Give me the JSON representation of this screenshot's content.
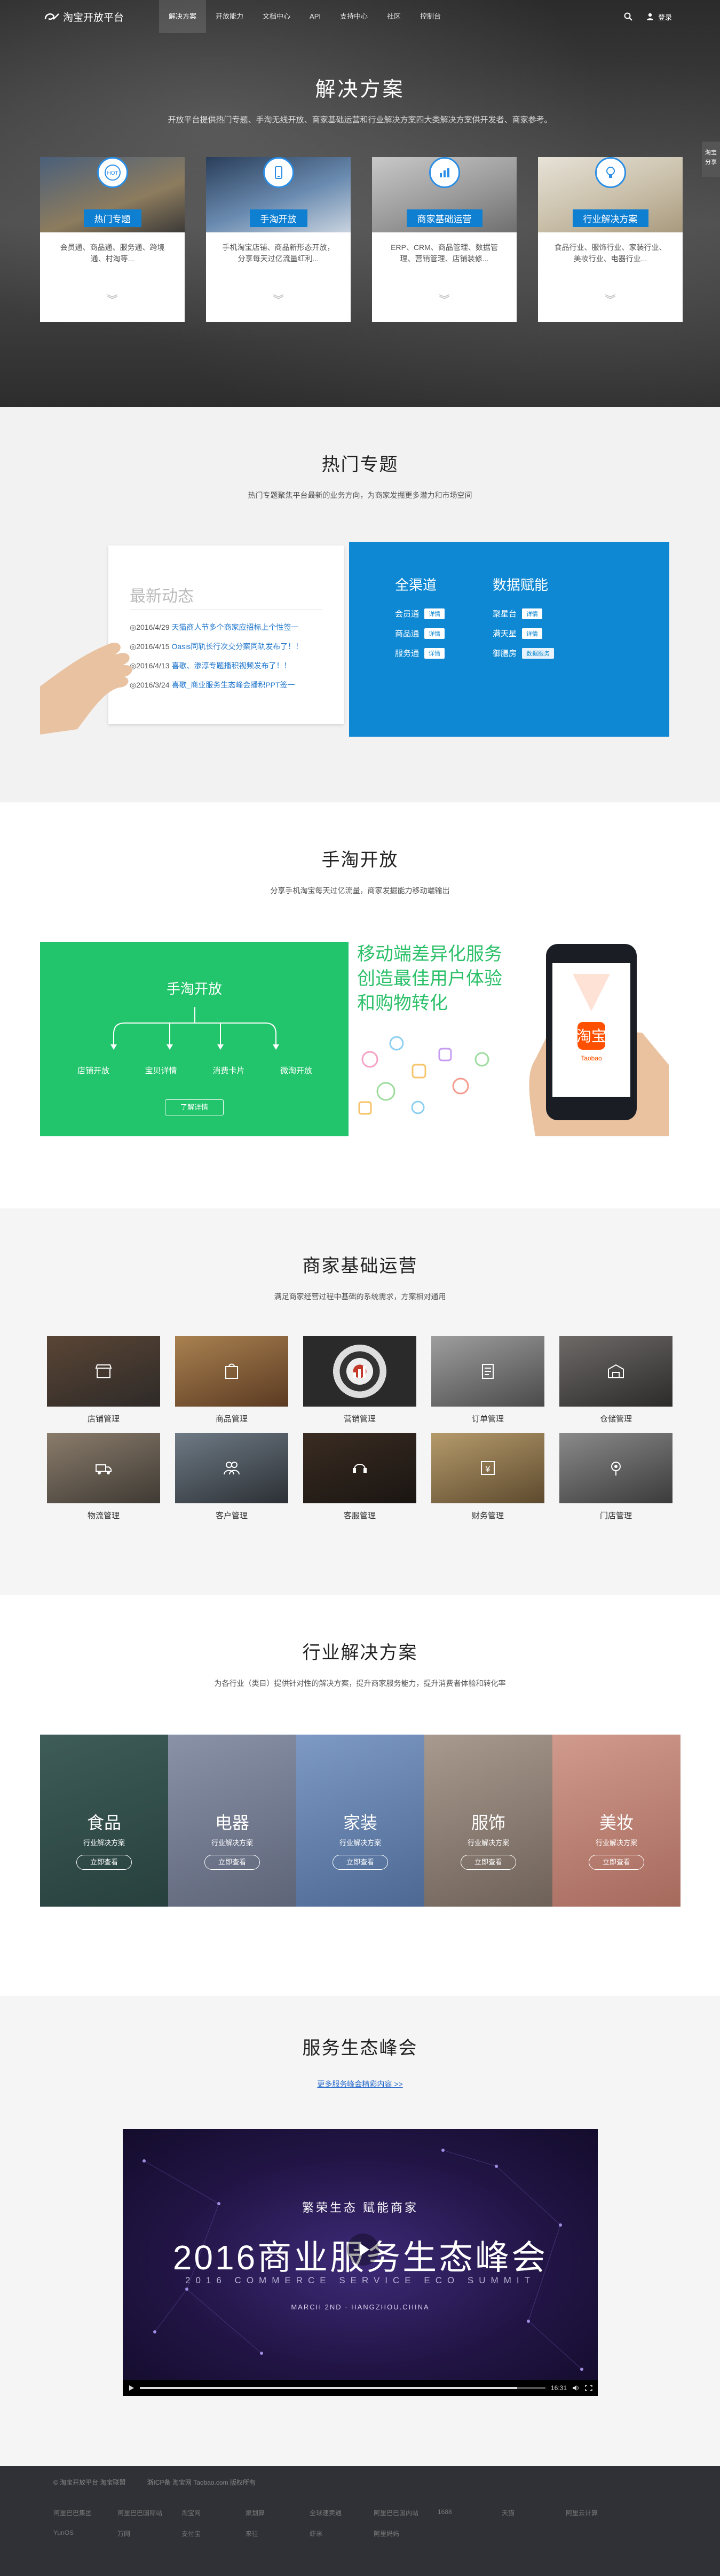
{
  "nav": {
    "logo_text": "淘宝开放平台",
    "items": [
      "解决方案",
      "开放能力",
      "文档中心",
      "API",
      "支持中心",
      "社区",
      "控制台"
    ],
    "login": "登录"
  },
  "hero": {
    "title": "解决方案",
    "subtitle": "开放平台提供热门专题、手淘无线开放、商家基础运营和行业解决方案四大类解决方案供开发者、商家参考。",
    "side_tab": [
      "淘宝",
      "分享"
    ],
    "cards": [
      {
        "label": "热门专题",
        "desc": "会员通、商品通、服务通、跨境通、村淘等..."
      },
      {
        "label": "手淘开放",
        "desc": "手机淘宝店铺、商品新形态开放，分享每天过亿流量红利..."
      },
      {
        "label": "商家基础运营",
        "desc": "ERP、CRM、商品管理、数据管理、营销管理、店铺装修..."
      },
      {
        "label": "行业解决方案",
        "desc": "食品行业、服饰行业、家装行业、美妆行业、电器行业..."
      }
    ]
  },
  "hot": {
    "title": "热门专题",
    "subtitle": "热门专题聚焦平台最新的业务方向，为商家发掘更多潜力和市场空间",
    "news_title": "最新动态",
    "news": [
      {
        "date": "◎2016/4/29",
        "text": "天猫商人节多个商家应招标上个性签一"
      },
      {
        "date": "◎2016/4/15",
        "text": "Oasis同轨长行次交分案同轨发布了！！"
      },
      {
        "date": "◎2016/4/13",
        "text": "喜歌、渗淳专题播积视频发布了！！"
      },
      {
        "date": "◎2016/3/24",
        "text": "喜歌_商业服务生态峰会播积PPT签一"
      }
    ],
    "columns": [
      {
        "title": "全渠道",
        "items": [
          {
            "name": "会员通",
            "tag": "详情"
          },
          {
            "name": "商品通",
            "tag": "详情"
          },
          {
            "name": "服务通",
            "tag": "详情"
          }
        ]
      },
      {
        "title": "数据赋能",
        "items": [
          {
            "name": "聚星台",
            "tag": "详情"
          },
          {
            "name": "满天星",
            "tag": "详情"
          },
          {
            "name": "御膳房",
            "tag": "数据服务"
          }
        ]
      }
    ]
  },
  "handtao": {
    "title": "手淘开放",
    "subtitle": "分享手机淘宝每天过亿流量，商家发掘能力移动端输出",
    "green_title": "手淘开放",
    "leaves": [
      "店铺开放",
      "宝贝详情",
      "消费卡片",
      "微淘开放"
    ],
    "button": "了解详情",
    "slogan": [
      "移动端差异化服务",
      "创造最佳用户体验",
      "和购物转化"
    ],
    "phone_app": "淘宝",
    "phone_tag": "Taobao"
  },
  "merch": {
    "title": "商家基础运营",
    "subtitle": "满足商家经营过程中基础的系统需求，方案相对通用",
    "items": [
      "店铺管理",
      "商品管理",
      "营销管理",
      "订单管理",
      "仓储管理",
      "物流管理",
      "客户管理",
      "客服管理",
      "财务管理",
      "门店管理"
    ]
  },
  "industry": {
    "title": "行业解决方案",
    "subtitle": "为各行业（类目）提供针对性的解决方案，提升商家服务能力，提升消费者体验和转化率",
    "items": [
      {
        "name": "食品",
        "tag": "行业解决方案",
        "btn": "立即查看"
      },
      {
        "name": "电器",
        "tag": "行业解决方案",
        "btn": "立即查看"
      },
      {
        "name": "家装",
        "tag": "行业解决方案",
        "btn": "立即查看"
      },
      {
        "name": "服饰",
        "tag": "行业解决方案",
        "btn": "立即查看"
      },
      {
        "name": "美妆",
        "tag": "行业解决方案",
        "btn": "立即查看"
      }
    ]
  },
  "summit": {
    "title": "服务生态峰会",
    "link": "更多服务峰会精彩内容 >>",
    "video": {
      "line1": "繁荣生态 赋能商家",
      "line2": "2016商业服务生态峰会",
      "line3": "2016 COMMERCE SERVICE ECO SUMMIT",
      "line4": "MARCH 2ND · HANGZHOU.CHINA",
      "progress": 0.93,
      "time": "16:31"
    }
  },
  "footer": {
    "top": [
      "© 淘宝开放平台 淘宝联盟",
      "浙ICP备 淘宝网 Taobao.com 版权所有"
    ],
    "links_row1": [
      "阿里巴巴集团",
      "阿里巴巴国际站",
      "淘宝网",
      "聚划算",
      "全球速卖通",
      "阿里巴巴国内站",
      "1688",
      "天猫",
      "阿里云计算",
      "YunOS",
      "万网"
    ],
    "links_row2": [
      "支付宝",
      "来往",
      "虾米",
      "阿里妈妈"
    ]
  }
}
